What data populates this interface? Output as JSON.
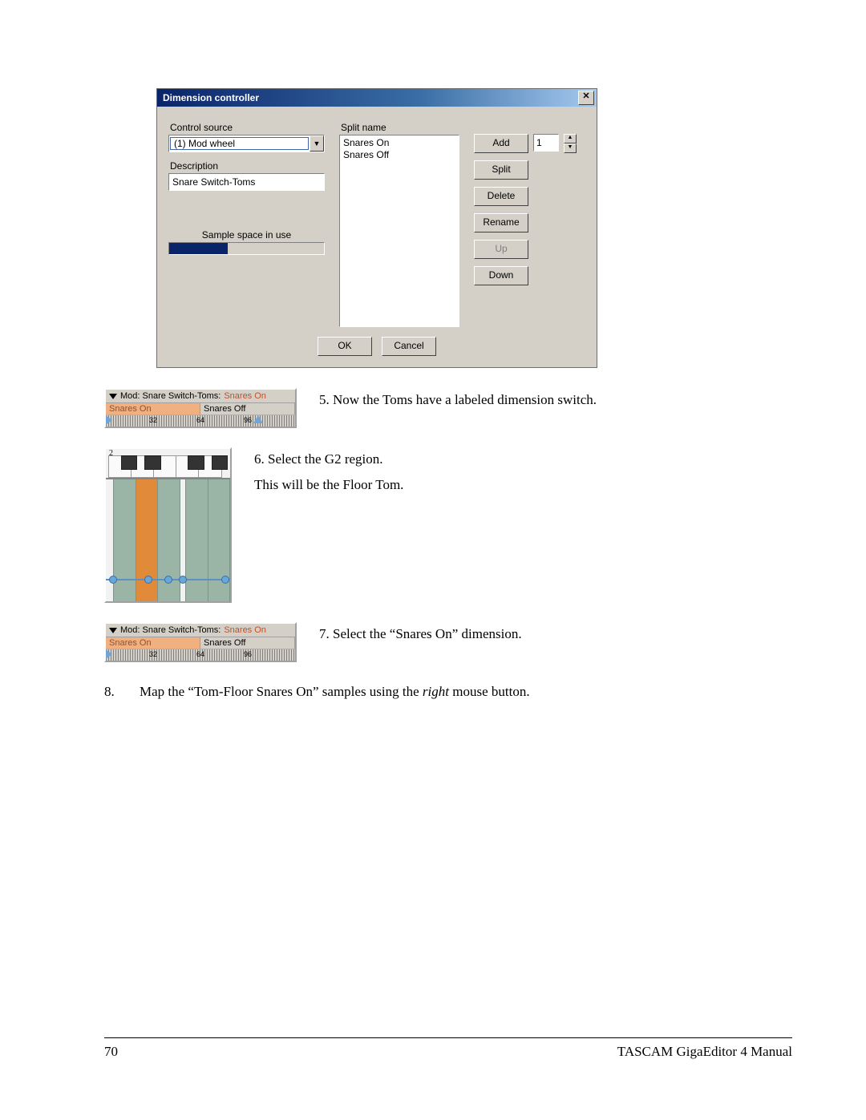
{
  "dialog": {
    "title": "Dimension controller",
    "controlSourceLabel": "Control source",
    "controlSourceValue": "(1) Mod wheel",
    "descriptionLabel": "Description",
    "descriptionValue": "Snare Switch-Toms",
    "sampleSpaceLabel": "Sample space in use",
    "sampleSpacePercent": 38,
    "splitNameLabel": "Split name",
    "splitItems": [
      "Snares On",
      "Snares Off"
    ],
    "buttons": {
      "add": "Add",
      "split": "Split",
      "delete": "Delete",
      "rename": "Rename",
      "up": "Up",
      "down": "Down",
      "ok": "OK",
      "cancel": "Cancel"
    },
    "spinnerValue": "1"
  },
  "modSwitch": {
    "prefix": "Mod: Snare Switch-Toms:",
    "state": "Snares On",
    "splitLeft": "Snares On",
    "splitRight": "Snares Off",
    "ticks": [
      "32",
      "64",
      "96"
    ]
  },
  "steps": {
    "s5": "5. Now the Toms have a labeled dimension switch.",
    "s6": "6. Select the G2 region.",
    "s6b": "This will be the Floor Tom.",
    "s7": "7. Select the “Snares On” dimension.",
    "s8num": "8.",
    "s8a": "Map the “Tom-Floor Snares On” samples using the ",
    "s8em": "right",
    "s8b": " mouse button."
  },
  "footer": {
    "page": "70",
    "title": "TASCAM GigaEditor 4 Manual"
  }
}
